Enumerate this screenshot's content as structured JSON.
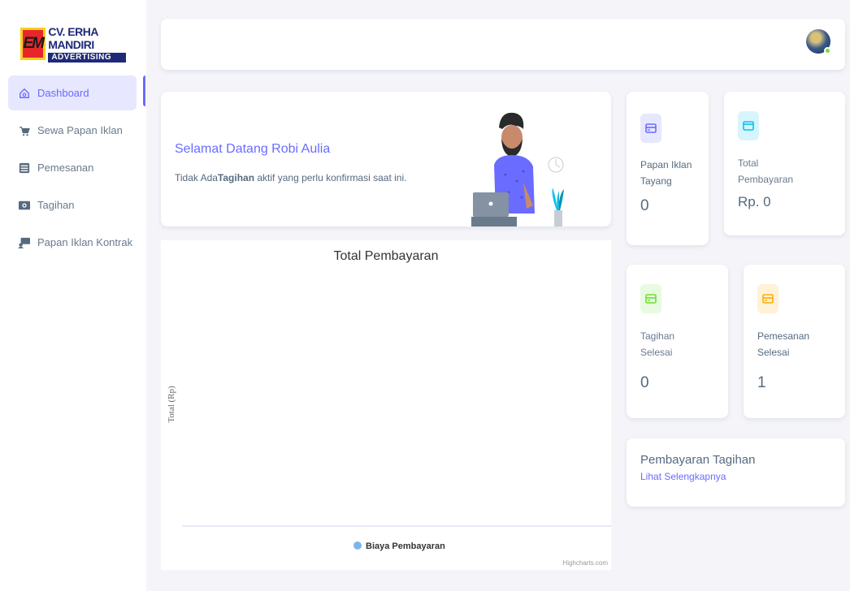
{
  "brand": {
    "logo_mark": "EM",
    "name_line1": "CV. ERHA MANDIRI",
    "name_line2": "ADVERTISING"
  },
  "sidebar": {
    "items": [
      {
        "label": "Dashboard",
        "icon": "home-icon",
        "active": true
      },
      {
        "label": "Sewa Papan Iklan",
        "icon": "cart-icon",
        "active": false
      },
      {
        "label": "Pemesanan",
        "icon": "list-icon",
        "active": false
      },
      {
        "label": "Tagihan",
        "icon": "money-icon",
        "active": false
      },
      {
        "label": "Papan Iklan Kontrak",
        "icon": "billboard-icon",
        "active": false
      }
    ]
  },
  "welcome": {
    "title": "Selamat Datang Robi Aulia",
    "text_prefix": "Tidak Ada",
    "text_bold": "Tagihan",
    "text_suffix": " aktif yang perlu konfirmasi saat ini."
  },
  "stats": {
    "papan_tayang": {
      "title_line1": "Papan Iklan",
      "title_line2": "Tayang",
      "value": "0",
      "color": "#696cff"
    },
    "total_pembayaran": {
      "title_line1": "Total",
      "title_line2": "Pembayaran",
      "value": "Rp. 0",
      "color": "#03c3ec"
    },
    "tagihan_selesai": {
      "title_line1": "Tagihan",
      "title_line2": "Selesai",
      "value": "0",
      "color": "#71dd37"
    },
    "pemesanan_selesai": {
      "title_line1": "Pemesanan",
      "title_line2": "Selesai",
      "value": "1",
      "color": "#ffab00"
    }
  },
  "pembayaran_tagihan": {
    "title": "Pembayaran Tagihan",
    "link": "Lihat Selengkapnya"
  },
  "chart_data": {
    "type": "bar",
    "title": "Total Pembayaran",
    "ylabel": "Total (Rp)",
    "xlabel": "",
    "categories": [],
    "series": [
      {
        "name": "Biaya Pembayaran",
        "values": [],
        "color": "#7cb5ec"
      }
    ],
    "credit": "Highcharts.com",
    "legend": "bottom-center"
  },
  "colors": {
    "accent": "#696cff",
    "background": "#f5f5f9"
  }
}
